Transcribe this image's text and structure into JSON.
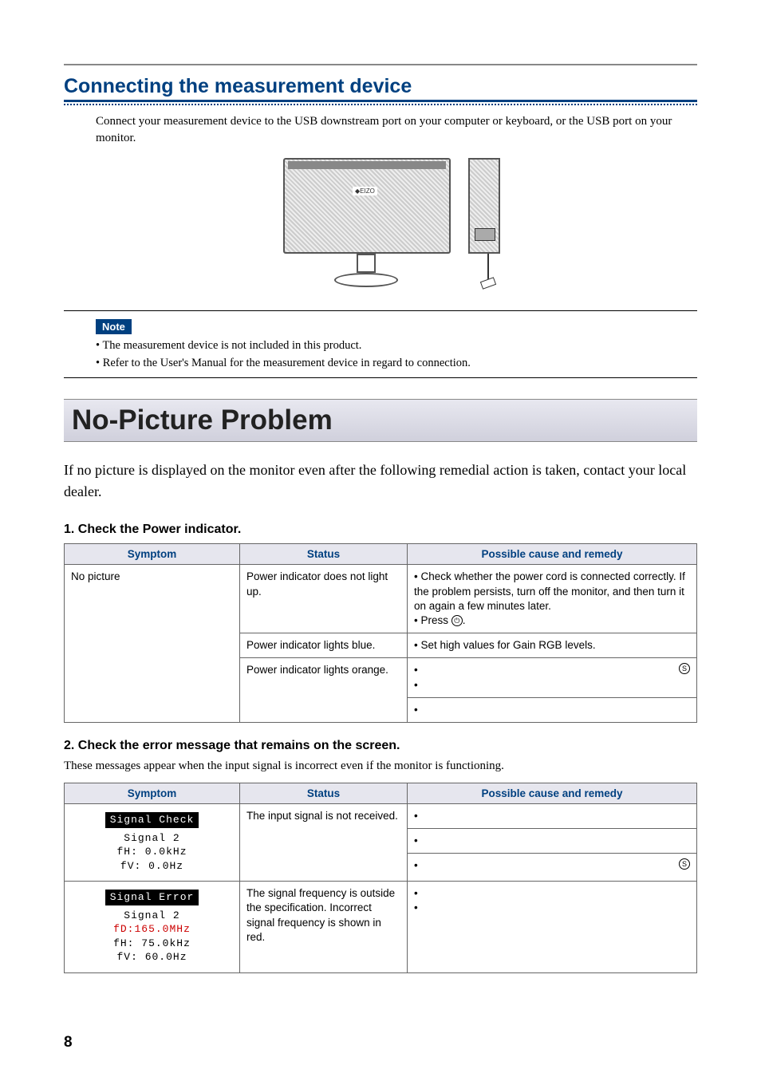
{
  "section_title": "Connecting the measurement device",
  "section_body": "Connect your measurement device to the USB downstream port on your computer or keyboard, or the USB port on your monitor.",
  "note_label": "Note",
  "notes": [
    "The measurement device is not included in this product.",
    "Refer to the User's Manual for the measurement device in regard to connection."
  ],
  "major_heading": "No-Picture Problem",
  "lead_text": "If no picture is displayed on the monitor even after the following remedial action is taken, contact your local dealer.",
  "sub1_heading": "1. Check the Power indicator.",
  "table_headers": {
    "symptom": "Symptom",
    "status": "Status",
    "remedy": "Possible cause and remedy"
  },
  "table1": {
    "symptom": "No picture",
    "rows": [
      {
        "status": "Power indicator does not light up.",
        "remedy_lines": [
          "• Check whether the power cord is connected correctly. If the problem persists, turn off the monitor, and then turn it on again a few minutes later.",
          "• Press ⏻."
        ]
      },
      {
        "status": "Power indicator lights blue.",
        "remedy_lines": [
          "• Set high values for Gain RGB levels."
        ]
      },
      {
        "status": "Power indicator lights orange.",
        "remedy_lines": [
          "•",
          "•",
          "•"
        ],
        "remedy_icon_s": true
      }
    ]
  },
  "sub2_heading": "2. Check the error message that remains on the screen.",
  "sub2_note": "These messages appear when the input signal is incorrect even if the monitor is functioning.",
  "table2": {
    "rows": [
      {
        "symptom_box": {
          "title": "Signal Check",
          "lines": [
            "Signal 2",
            "fH:  0.0kHz",
            "fV:  0.0Hz"
          ]
        },
        "status": "The input signal is not received.",
        "remedy_lines": [
          "•",
          "•",
          "•"
        ],
        "remedy_icon_s": true
      },
      {
        "symptom_box": {
          "title": "Signal Error",
          "lines": [
            "Signal 2",
            "fD:165.0MHz",
            "fH: 75.0kHz",
            "fV: 60.0Hz"
          ],
          "red_line_index": 1
        },
        "status": "The signal frequency is outside the specification. Incorrect signal frequency is shown in red.",
        "remedy_lines": [
          "•",
          "•"
        ]
      }
    ]
  },
  "page_number": "8",
  "icons": {
    "power": "⏻",
    "s_button": "S"
  }
}
